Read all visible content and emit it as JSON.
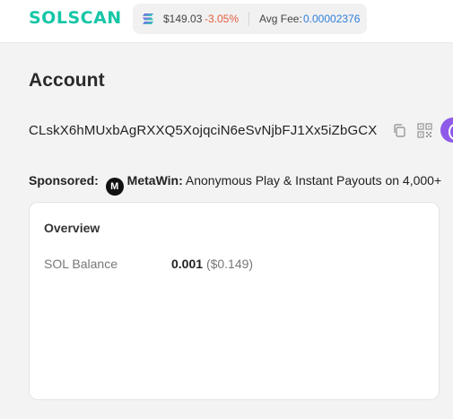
{
  "header": {
    "logo_text": "SOLSCAN",
    "sol_price": "$149.03",
    "sol_change": "-3.05%",
    "avg_fee_label": "Avg Fee:",
    "avg_fee_value": "0.00002376"
  },
  "account": {
    "title": "Account",
    "address": "CLskX6hMUxbAgRXXQ5XojqciN6eSvNjbFJ1Xx5iZbGCX"
  },
  "sponsor": {
    "label": "Sponsored:",
    "brand": "MetaWin:",
    "text": "Anonymous Play & Instant Payouts on 4,000+"
  },
  "overview": {
    "title": "Overview",
    "sol_balance_label": "SOL Balance",
    "sol_balance_amount": "0.001",
    "sol_balance_usd": "($0.149)"
  },
  "colors": {
    "brand": "#16c6a7",
    "negative": "#e35d3d",
    "link": "#2f7fd8",
    "accent_purple": "#8f5ae8"
  },
  "icons": [
    "solana-icon",
    "copy-icon",
    "qr-code-icon",
    "metawin-logo-icon"
  ]
}
